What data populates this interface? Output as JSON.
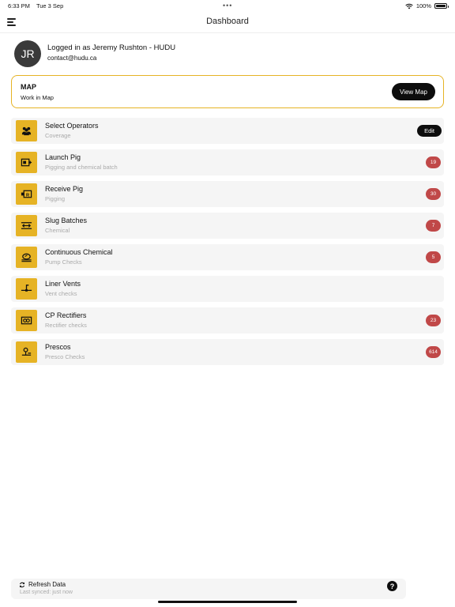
{
  "status_bar": {
    "time": "6:33 PM",
    "date": "Tue 3 Sep",
    "dots": "•••",
    "battery": "100%"
  },
  "nav": {
    "title": "Dashboard"
  },
  "user": {
    "initials": "JR",
    "logged_in_text": "Logged in as Jeremy Rushton - HUDU",
    "email": "contact@hudu.ca"
  },
  "map_card": {
    "title": "MAP",
    "subtitle": "Work in Map",
    "button_label": "View Map"
  },
  "colors": {
    "accent": "#e6b325",
    "badge": "#c04848",
    "dark": "#0d0d0d"
  },
  "items": [
    {
      "title": "Select Operators",
      "subtitle": "Coverage",
      "icon": "operators-icon",
      "action": "Edit"
    },
    {
      "title": "Launch Pig",
      "subtitle": "Pigging and chemical batch",
      "icon": "launch-pig-icon",
      "badge": "19"
    },
    {
      "title": "Receive Pig",
      "subtitle": "Pigging",
      "icon": "receive-pig-icon",
      "badge": "30"
    },
    {
      "title": "Slug Batches",
      "subtitle": "Chemical",
      "icon": "slug-batch-icon",
      "badge": "7"
    },
    {
      "title": "Continuous Chemical",
      "subtitle": "Pump Checks",
      "icon": "pump-icon",
      "badge": "5"
    },
    {
      "title": "Liner Vents",
      "subtitle": "Vent checks",
      "icon": "vent-icon"
    },
    {
      "title": "CP Rectifiers",
      "subtitle": "Rectifier checks",
      "icon": "rectifier-icon",
      "badge": "23"
    },
    {
      "title": "Prescos",
      "subtitle": "Presco Checks",
      "icon": "presco-icon",
      "badge": "614"
    }
  ],
  "footer": {
    "refresh_label": "Refresh Data",
    "last_synced": "Last synced: just now",
    "help": "?"
  }
}
